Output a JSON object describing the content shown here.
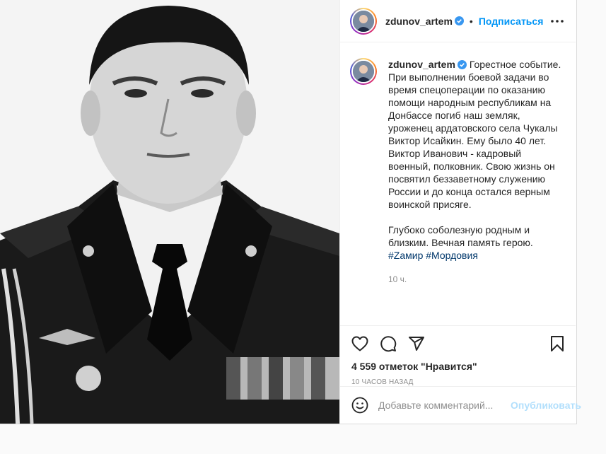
{
  "post": {
    "author": {
      "username": "zdunov_artem",
      "verified": true,
      "follow_label": "Подписаться",
      "separator": "•"
    },
    "caption": {
      "paragraph1": "Горестное событие. При выполнении боевой задачи во время спецоперации по оказанию помощи народным республикам на Донбассе погиб наш земляк, уроженец ардатовского села Чукалы Виктор Исайкин. Ему было 40 лет. Виктор Иванович - кадровый военный, полковник. Свою жизнь он посвятил беззаветному служению России и до конца остался верным воинской присяге.",
      "paragraph2": "Глубоко соболезную родным и близким. Вечная память герою.",
      "hashtags": [
        "#Zамир",
        "#Мордовия"
      ],
      "time_ago": "10 ч."
    },
    "likes_text": "4 559 отметок \"Нравится\"",
    "posted_ago": "10 часов назад",
    "comment": {
      "placeholder": "Добавьте комментарий...",
      "value": "",
      "publish_label": "Опубликовать"
    },
    "icons": {
      "like": "heart-icon",
      "comment": "comment-icon",
      "share": "share-icon",
      "save": "bookmark-icon",
      "more": "more-icon",
      "emoji": "emoji-icon",
      "verified": "verified-badge-icon"
    },
    "colors": {
      "link": "#0095f6",
      "hashtag": "#00376b",
      "verified": "#3897f0",
      "muted": "#8e8e8e",
      "publish_disabled": "#b2dffc"
    }
  }
}
